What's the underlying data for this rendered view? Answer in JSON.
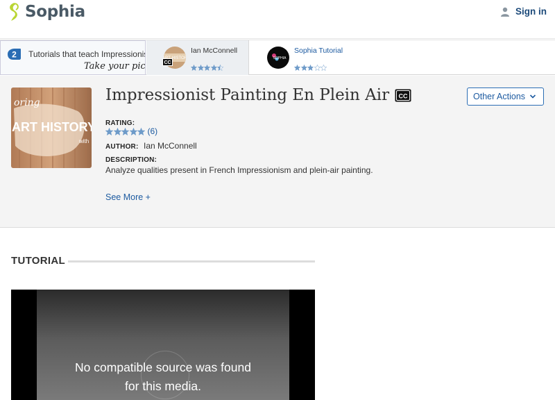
{
  "header": {
    "logo_text": "Sophia",
    "signin_label": "Sign in",
    "brand_color": "#b9d533"
  },
  "picker": {
    "count": "2",
    "text": "Tutorials that teach Impressionist",
    "handwritten": "Take your pick:",
    "tutorials": [
      {
        "name": "Ian McConnell",
        "cc": "CC",
        "rating_stars": 4.5,
        "active": true
      },
      {
        "name": "Sophia Tutorial",
        "rating_stars": 3,
        "active": false
      }
    ]
  },
  "lesson": {
    "title": "Impressionist Painting En Plein Air",
    "title_cc": "CC",
    "thumb_text_top": "oring",
    "thumb_text_main": "ART HISTORY",
    "thumb_text_small": "with",
    "rating_label": "RATING:",
    "rating_stars": 5,
    "rating_count": "(6)",
    "author_label": "AUTHOR:",
    "author": "Ian McConnell",
    "description_label": "DESCRIPTION:",
    "description": "Analyze qualities present in French Impressionism and plein-air painting.",
    "see_more": "See More +",
    "other_actions": "Other Actions"
  },
  "tutorial_section": {
    "title": "TUTORIAL",
    "video_message_line1": "No compatible source was found",
    "video_message_line2": "for this media."
  }
}
